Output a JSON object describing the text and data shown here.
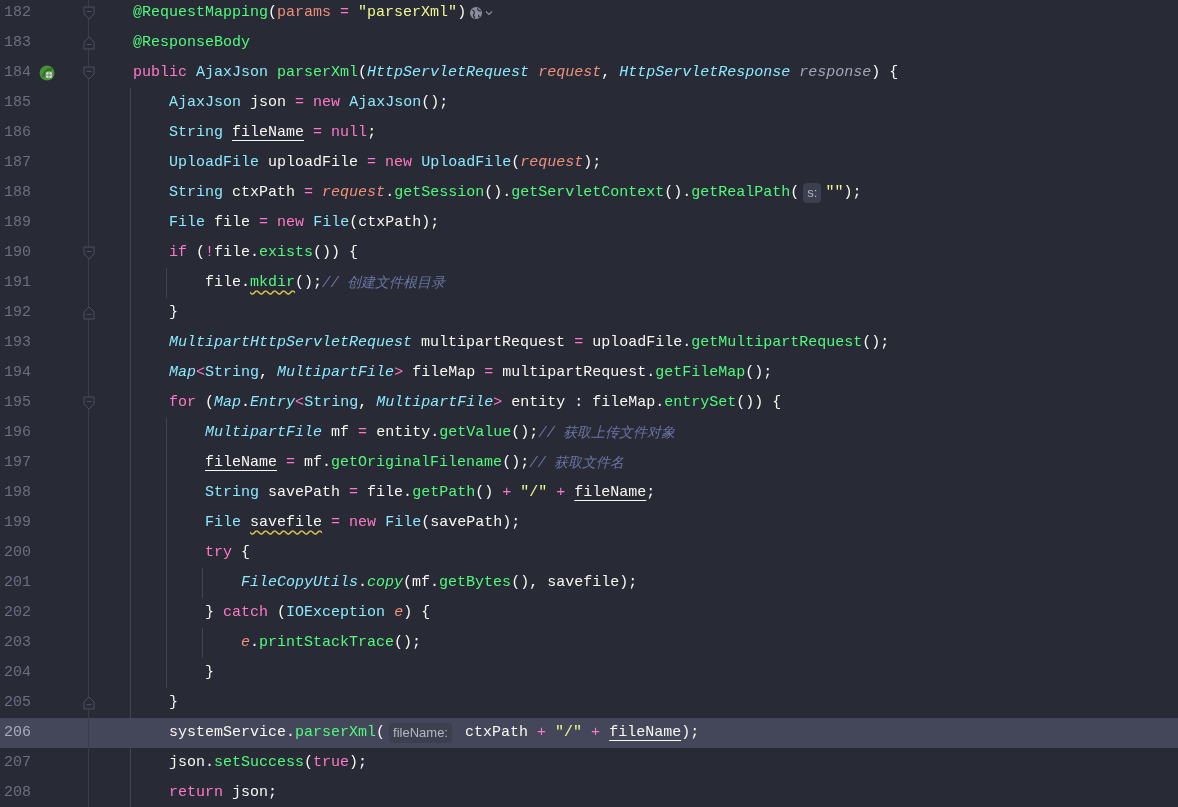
{
  "lines": [
    {
      "number": "182",
      "fold_marker": {
        "kind": "start"
      },
      "web_icon": true,
      "current": false,
      "tokens": [
        {
          "kind": "annotation",
          "t": "@RequestMapping"
        },
        {
          "kind": "plain",
          "t": "("
        },
        {
          "kind": "attr",
          "t": "params"
        },
        {
          "kind": "op",
          "t": " = "
        },
        {
          "kind": "string",
          "t": "\"parserXml\""
        },
        {
          "kind": "plain",
          "t": ")"
        }
      ]
    },
    {
      "number": "183",
      "fold_marker": {
        "kind": "end"
      },
      "current": false,
      "tokens": [
        {
          "kind": "annotation",
          "t": "@ResponseBody"
        }
      ]
    },
    {
      "number": "184",
      "fold_marker": {
        "kind": "start"
      },
      "gutter_icon": true,
      "current": false,
      "tokens": [
        {
          "kind": "keyword",
          "t": "public "
        },
        {
          "kind": "type",
          "t": "AjaxJson "
        },
        {
          "kind": "method",
          "t": "parserXml"
        },
        {
          "kind": "plain",
          "t": "("
        },
        {
          "kind": "type_italic",
          "t": "HttpServletRequest "
        },
        {
          "kind": "param",
          "t": "request"
        },
        {
          "kind": "plain",
          "t": ", "
        },
        {
          "kind": "type_italic",
          "t": "HttpServletResponse "
        },
        {
          "kind": "unused",
          "t": "response"
        },
        {
          "kind": "plain",
          "t": ") {"
        }
      ]
    },
    {
      "number": "185",
      "current": false,
      "tokens": [
        {
          "kind": "type",
          "t": "    AjaxJson"
        },
        {
          "kind": "plain",
          "t": " json "
        },
        {
          "kind": "op",
          "t": "= "
        },
        {
          "kind": "keyword",
          "t": "new "
        },
        {
          "kind": "type",
          "t": "AjaxJson"
        },
        {
          "kind": "plain",
          "t": "();"
        }
      ]
    },
    {
      "number": "186",
      "current": false,
      "tokens": [
        {
          "kind": "type",
          "t": "    String "
        },
        {
          "kind": "underlined",
          "t": "fileName "
        },
        {
          "kind": "op",
          "t": "= "
        },
        {
          "kind": "keyword",
          "t": "null"
        },
        {
          "kind": "plain",
          "t": ";"
        }
      ]
    },
    {
      "number": "187",
      "current": false,
      "tokens": [
        {
          "kind": "type",
          "t": "    UploadFile"
        },
        {
          "kind": "plain",
          "t": " uploadFile "
        },
        {
          "kind": "op",
          "t": "= "
        },
        {
          "kind": "keyword",
          "t": "new "
        },
        {
          "kind": "type",
          "t": "UploadFile"
        },
        {
          "kind": "plain",
          "t": "("
        },
        {
          "kind": "param",
          "t": "request"
        },
        {
          "kind": "plain",
          "t": ");"
        }
      ]
    },
    {
      "number": "188",
      "current": false,
      "tokens": [
        {
          "kind": "type",
          "t": "    String"
        },
        {
          "kind": "plain",
          "t": " ctxPath "
        },
        {
          "kind": "op",
          "t": "= "
        },
        {
          "kind": "param",
          "t": "request"
        },
        {
          "kind": "plain",
          "t": "."
        },
        {
          "kind": "method",
          "t": "getSession"
        },
        {
          "kind": "plain",
          "t": "()."
        },
        {
          "kind": "method",
          "t": "getServletContext"
        },
        {
          "kind": "plain",
          "t": "()."
        },
        {
          "kind": "method",
          "t": "getRealPath"
        },
        {
          "kind": "plain",
          "t": "("
        },
        {
          "kind": "hint",
          "t": "s:"
        },
        {
          "kind": "string",
          "t": "\"\""
        },
        {
          "kind": "plain",
          "t": ");"
        }
      ]
    },
    {
      "number": "189",
      "current": false,
      "tokens": [
        {
          "kind": "type",
          "t": "    File"
        },
        {
          "kind": "plain",
          "t": " file "
        },
        {
          "kind": "op",
          "t": "= "
        },
        {
          "kind": "keyword",
          "t": "new "
        },
        {
          "kind": "type",
          "t": "File"
        },
        {
          "kind": "plain",
          "t": "(ctxPath);"
        }
      ]
    },
    {
      "number": "190",
      "fold_marker": {
        "kind": "start"
      },
      "current": false,
      "tokens": [
        {
          "kind": "keyword",
          "t": "    if"
        },
        {
          "kind": "plain",
          "t": " ("
        },
        {
          "kind": "op",
          "t": "!"
        },
        {
          "kind": "plain",
          "t": "file."
        },
        {
          "kind": "method",
          "t": "exists"
        },
        {
          "kind": "plain",
          "t": "()) {"
        }
      ]
    },
    {
      "number": "191",
      "current": false,
      "tokens": [
        {
          "kind": "plain",
          "t": "        file."
        },
        {
          "kind": "method_warning",
          "t": "mkdir"
        },
        {
          "kind": "plain",
          "t": "();"
        },
        {
          "kind": "comment",
          "t": "// 创建文件根目录"
        }
      ]
    },
    {
      "number": "192",
      "fold_marker": {
        "kind": "end"
      },
      "current": false,
      "tokens": [
        {
          "kind": "plain",
          "t": "    }"
        }
      ]
    },
    {
      "number": "193",
      "current": false,
      "tokens": [
        {
          "kind": "type_italic",
          "t": "    MultipartHttpServletRequest"
        },
        {
          "kind": "plain",
          "t": " multipartRequest "
        },
        {
          "kind": "op",
          "t": "="
        },
        {
          "kind": "plain",
          "t": " uploadFile."
        },
        {
          "kind": "method",
          "t": "getMultipartRequest"
        },
        {
          "kind": "plain",
          "t": "();"
        }
      ]
    },
    {
      "number": "194",
      "current": false,
      "tokens": [
        {
          "kind": "type_italic",
          "t": "    Map"
        },
        {
          "kind": "op",
          "t": "<"
        },
        {
          "kind": "type",
          "t": "String"
        },
        {
          "kind": "plain",
          "t": ", "
        },
        {
          "kind": "type_italic",
          "t": "MultipartFile"
        },
        {
          "kind": "op",
          "t": ">"
        },
        {
          "kind": "plain",
          "t": " fileMap "
        },
        {
          "kind": "op",
          "t": "="
        },
        {
          "kind": "plain",
          "t": " multipartRequest."
        },
        {
          "kind": "method",
          "t": "getFileMap"
        },
        {
          "kind": "plain",
          "t": "();"
        }
      ]
    },
    {
      "number": "195",
      "fold_marker": {
        "kind": "start"
      },
      "current": false,
      "tokens": [
        {
          "kind": "keyword",
          "t": "    for"
        },
        {
          "kind": "plain",
          "t": " ("
        },
        {
          "kind": "type_italic",
          "t": "Map"
        },
        {
          "kind": "plain",
          "t": "."
        },
        {
          "kind": "type_italic",
          "t": "Entry"
        },
        {
          "kind": "op",
          "t": "<"
        },
        {
          "kind": "type",
          "t": "String"
        },
        {
          "kind": "plain",
          "t": ", "
        },
        {
          "kind": "type_italic",
          "t": "MultipartFile"
        },
        {
          "kind": "op",
          "t": ">"
        },
        {
          "kind": "plain",
          "t": " entity : fileMap."
        },
        {
          "kind": "method",
          "t": "entrySet"
        },
        {
          "kind": "plain",
          "t": "()) {"
        }
      ]
    },
    {
      "number": "196",
      "current": false,
      "tokens": [
        {
          "kind": "type_italic",
          "t": "        MultipartFile"
        },
        {
          "kind": "plain",
          "t": " mf "
        },
        {
          "kind": "op",
          "t": "="
        },
        {
          "kind": "plain",
          "t": " entity."
        },
        {
          "kind": "method",
          "t": "getValue"
        },
        {
          "kind": "plain",
          "t": "();"
        },
        {
          "kind": "comment",
          "t": "// 获取上传文件对象"
        }
      ]
    },
    {
      "number": "197",
      "current": false,
      "tokens": [
        {
          "kind": "underlined",
          "t": "        fileName "
        },
        {
          "kind": "op",
          "t": "="
        },
        {
          "kind": "plain",
          "t": " mf."
        },
        {
          "kind": "method",
          "t": "getOriginalFilename"
        },
        {
          "kind": "plain",
          "t": "();"
        },
        {
          "kind": "comment",
          "t": "// 获取文件名"
        }
      ]
    },
    {
      "number": "198",
      "current": false,
      "tokens": [
        {
          "kind": "type",
          "t": "        String"
        },
        {
          "kind": "plain",
          "t": " savePath "
        },
        {
          "kind": "op",
          "t": "="
        },
        {
          "kind": "plain",
          "t": " file."
        },
        {
          "kind": "method",
          "t": "getPath"
        },
        {
          "kind": "plain",
          "t": "() "
        },
        {
          "kind": "op",
          "t": "+ "
        },
        {
          "kind": "string",
          "t": "\"/\" "
        },
        {
          "kind": "op",
          "t": "+ "
        },
        {
          "kind": "underlined",
          "t": "fileName"
        },
        {
          "kind": "plain",
          "t": ";"
        }
      ]
    },
    {
      "number": "199",
      "current": false,
      "tokens": [
        {
          "kind": "type",
          "t": "        File "
        },
        {
          "kind": "warning",
          "t": "savefile "
        },
        {
          "kind": "op",
          "t": "= "
        },
        {
          "kind": "keyword",
          "t": "new "
        },
        {
          "kind": "type",
          "t": "File"
        },
        {
          "kind": "plain",
          "t": "(savePath);"
        }
      ]
    },
    {
      "number": "200",
      "current": false,
      "tokens": [
        {
          "kind": "keyword",
          "t": "        try"
        },
        {
          "kind": "plain",
          "t": " {"
        }
      ]
    },
    {
      "number": "201",
      "current": false,
      "tokens": [
        {
          "kind": "type_italic",
          "t": "            FileCopyUtils"
        },
        {
          "kind": "plain",
          "t": "."
        },
        {
          "kind": "method_italic",
          "t": "copy"
        },
        {
          "kind": "plain",
          "t": "(mf."
        },
        {
          "kind": "method",
          "t": "getBytes"
        },
        {
          "kind": "plain",
          "t": "(), savefile);"
        }
      ]
    },
    {
      "number": "202",
      "current": false,
      "tokens": [
        {
          "kind": "plain",
          "t": "        } "
        },
        {
          "kind": "keyword",
          "t": "catch"
        },
        {
          "kind": "plain",
          "t": " ("
        },
        {
          "kind": "type",
          "t": "IOException "
        },
        {
          "kind": "param",
          "t": "e"
        },
        {
          "kind": "plain",
          "t": ") {"
        }
      ]
    },
    {
      "number": "203",
      "current": false,
      "tokens": [
        {
          "kind": "param",
          "t": "            e"
        },
        {
          "kind": "plain",
          "t": "."
        },
        {
          "kind": "method",
          "t": "printStackTrace"
        },
        {
          "kind": "plain",
          "t": "();"
        }
      ]
    },
    {
      "number": "204",
      "current": false,
      "tokens": [
        {
          "kind": "plain",
          "t": "        }"
        }
      ]
    },
    {
      "number": "205",
      "fold_marker": {
        "kind": "end"
      },
      "current": false,
      "tokens": [
        {
          "kind": "plain",
          "t": "    }"
        }
      ]
    },
    {
      "number": "206",
      "current": true,
      "tokens": [
        {
          "kind": "plain",
          "t": "    systemService."
        },
        {
          "kind": "method",
          "t": "parserXml"
        },
        {
          "kind": "plain",
          "t": "("
        },
        {
          "kind": "hint",
          "t": "fileName:"
        },
        {
          "kind": "plain",
          "t": " ctxPath "
        },
        {
          "kind": "op",
          "t": "+ "
        },
        {
          "kind": "string",
          "t": "\"/\" "
        },
        {
          "kind": "op",
          "t": "+ "
        },
        {
          "kind": "underlined",
          "t": "fileName"
        },
        {
          "kind": "plain",
          "t": ");"
        }
      ]
    },
    {
      "number": "207",
      "current": false,
      "tokens": [
        {
          "kind": "plain",
          "t": "    json."
        },
        {
          "kind": "method",
          "t": "setSuccess"
        },
        {
          "kind": "plain",
          "t": "("
        },
        {
          "kind": "keyword",
          "t": "true"
        },
        {
          "kind": "plain",
          "t": ");"
        }
      ]
    },
    {
      "number": "208",
      "current": false,
      "tokens": [
        {
          "kind": "keyword",
          "t": "    return"
        },
        {
          "kind": "plain",
          "t": " json;"
        }
      ]
    }
  ]
}
